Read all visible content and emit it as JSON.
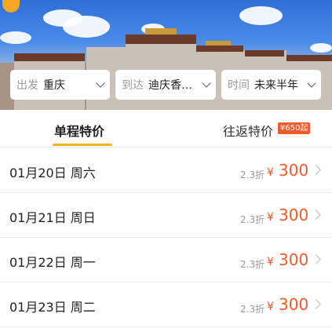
{
  "filters": {
    "departure": {
      "label": "出发",
      "value": "重庆"
    },
    "arrival": {
      "label": "到达",
      "value": "迪庆香…"
    },
    "time": {
      "label": "时间",
      "value": "未来半年"
    }
  },
  "tabs": {
    "one_way": "单程特价",
    "round_trip": "往返特价",
    "round_trip_badge": "¥650起"
  },
  "fares": [
    {
      "date": "01月20日 周六",
      "discount": "2.3折",
      "currency": "¥",
      "price": "300"
    },
    {
      "date": "01月21日 周日",
      "discount": "2.3折",
      "currency": "¥",
      "price": "300"
    },
    {
      "date": "01月22日 周一",
      "discount": "2.3折",
      "currency": "¥",
      "price": "300"
    },
    {
      "date": "01月23日 周二",
      "discount": "2.3折",
      "currency": "¥",
      "price": "300"
    }
  ],
  "colors": {
    "accent": "#f25a2b",
    "tab_indicator": "#f5b323"
  }
}
